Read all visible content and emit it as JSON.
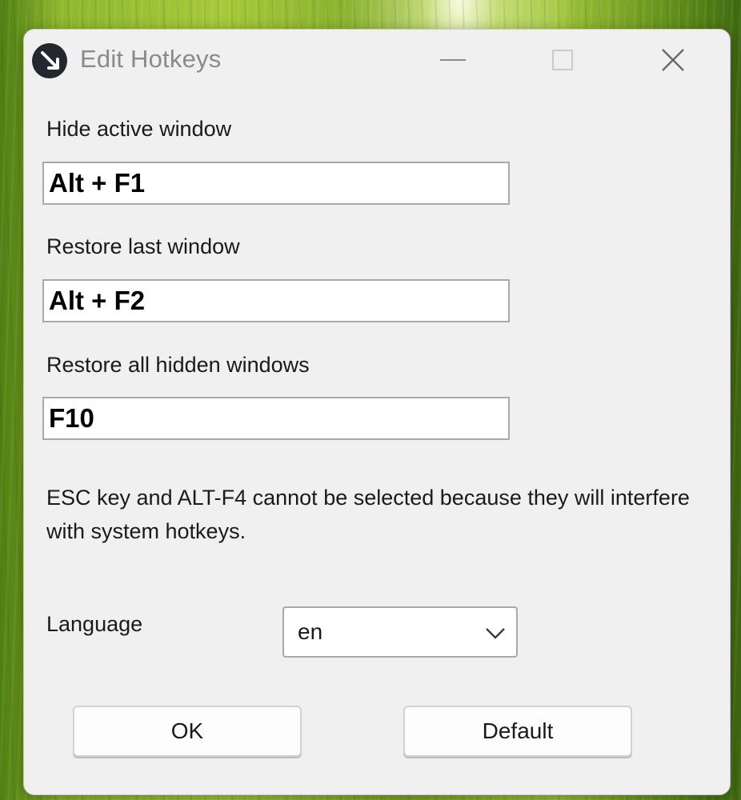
{
  "window": {
    "title": "Edit Hotkeys",
    "icon": "app-arrow-icon"
  },
  "titlebar_buttons": [
    "minimize-icon",
    "maximize-icon",
    "close-icon"
  ],
  "hotkeys": {
    "hide_active": {
      "label": "Hide active window",
      "value": "Alt + F1"
    },
    "restore_last": {
      "label": "Restore last window",
      "value": "Alt + F2"
    },
    "restore_all": {
      "label": "Restore all hidden windows",
      "value": "F10"
    }
  },
  "note": "ESC key and ALT-F4 cannot be selected because they will interfere with system hotkeys.",
  "language": {
    "label": "Language",
    "selected": "en"
  },
  "buttons": {
    "ok": "OK",
    "default": "Default"
  },
  "colors": {
    "dialog_bg": "#f0f0f0",
    "title_text": "#8a8a8a",
    "field_border": "#a9a9a9"
  }
}
